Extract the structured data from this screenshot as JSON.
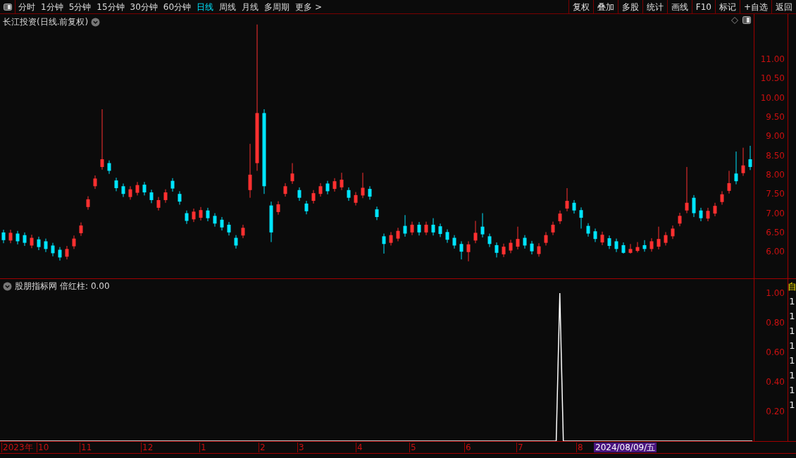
{
  "toolbar": {
    "periods": [
      {
        "label": "分时",
        "selected": false
      },
      {
        "label": "1分钟",
        "selected": false
      },
      {
        "label": "5分钟",
        "selected": false
      },
      {
        "label": "15分钟",
        "selected": false
      },
      {
        "label": "30分钟",
        "selected": false
      },
      {
        "label": "60分钟",
        "selected": false
      },
      {
        "label": "日线",
        "selected": true
      },
      {
        "label": "周线",
        "selected": false
      },
      {
        "label": "月线",
        "selected": false
      },
      {
        "label": "多周期",
        "selected": false
      },
      {
        "label": "更多 >",
        "selected": false
      }
    ],
    "buttons": [
      "复权",
      "叠加",
      "多股",
      "统计",
      "画线",
      "F10",
      "标记",
      "+自选",
      "返回"
    ]
  },
  "price_panel": {
    "title": "长江投资(日线.前复权)",
    "chart_data": {
      "type": "candlestick",
      "ylim": [
        5.29,
        12.17
      ],
      "yticks": [
        {
          "value": 11,
          "label": "11.00"
        },
        {
          "value": 10.5,
          "label": "10.50"
        },
        {
          "value": 10,
          "label": "10.00"
        },
        {
          "value": 9.5,
          "label": "9.50"
        },
        {
          "value": 9,
          "label": "9.00"
        },
        {
          "value": 8.5,
          "label": "8.50"
        },
        {
          "value": 8,
          "label": "8.00"
        },
        {
          "value": 7.5,
          "label": "7.50"
        },
        {
          "value": 7,
          "label": "7.00"
        },
        {
          "value": 6.5,
          "label": "6.50"
        },
        {
          "value": 6,
          "label": "6.00"
        }
      ],
      "ohlc": [
        [
          6.5,
          6.57,
          6.22,
          6.3
        ],
        [
          6.29,
          6.57,
          6.22,
          6.49
        ],
        [
          6.47,
          6.54,
          6.19,
          6.27
        ],
        [
          6.43,
          6.5,
          6.15,
          6.23
        ],
        [
          6.16,
          6.44,
          6.09,
          6.36
        ],
        [
          6.32,
          6.39,
          6.04,
          6.12
        ],
        [
          6.27,
          6.34,
          5.99,
          6.07
        ],
        [
          6.16,
          6.23,
          5.88,
          5.96
        ],
        [
          6.05,
          6.12,
          5.77,
          5.85
        ],
        [
          5.87,
          6.15,
          5.8,
          6.07
        ],
        [
          6.14,
          6.42,
          6.07,
          6.34
        ],
        [
          6.48,
          6.76,
          6.41,
          6.68
        ],
        [
          7.16,
          7.44,
          7.09,
          7.36
        ],
        [
          7.7,
          7.98,
          7.63,
          7.9
        ],
        [
          8.2,
          9.7,
          8.13,
          8.4
        ],
        [
          8.3,
          8.37,
          8.02,
          8.1
        ],
        [
          7.85,
          7.92,
          7.57,
          7.65
        ],
        [
          7.7,
          7.77,
          7.42,
          7.5
        ],
        [
          7.42,
          7.7,
          7.35,
          7.62
        ],
        [
          7.53,
          7.81,
          7.46,
          7.73
        ],
        [
          7.74,
          7.81,
          7.46,
          7.54
        ],
        [
          7.54,
          7.61,
          7.26,
          7.34
        ],
        [
          7.14,
          7.42,
          7.07,
          7.34
        ],
        [
          7.34,
          7.62,
          7.27,
          7.54
        ],
        [
          7.84,
          7.91,
          7.56,
          7.64
        ],
        [
          7.5,
          7.57,
          7.22,
          7.3
        ],
        [
          7.0,
          7.07,
          6.72,
          6.8
        ],
        [
          6.84,
          7.12,
          6.77,
          7.04
        ],
        [
          6.88,
          7.16,
          6.81,
          7.08
        ],
        [
          7.07,
          7.14,
          6.79,
          6.87
        ],
        [
          6.93,
          7.0,
          6.65,
          6.73
        ],
        [
          6.83,
          6.9,
          6.55,
          6.63
        ],
        [
          6.7,
          6.77,
          6.42,
          6.5
        ],
        [
          6.36,
          6.43,
          6.08,
          6.16
        ],
        [
          6.42,
          6.7,
          6.35,
          6.62
        ],
        [
          7.6,
          8.8,
          7.4,
          8.0
        ],
        [
          8.3,
          11.9,
          8.1,
          9.6
        ],
        [
          9.6,
          9.7,
          7.5,
          7.7
        ],
        [
          7.2,
          7.3,
          6.25,
          6.5
        ],
        [
          7.03,
          7.31,
          6.96,
          7.23
        ],
        [
          7.5,
          7.78,
          7.43,
          7.7
        ],
        [
          7.83,
          8.3,
          7.76,
          8.03
        ],
        [
          7.6,
          7.67,
          7.32,
          7.4
        ],
        [
          7.25,
          7.32,
          6.97,
          7.05
        ],
        [
          7.32,
          7.6,
          7.25,
          7.52
        ],
        [
          7.5,
          7.78,
          7.43,
          7.7
        ],
        [
          7.77,
          7.84,
          7.49,
          7.57
        ],
        [
          7.63,
          7.91,
          7.56,
          7.83
        ],
        [
          7.67,
          8.05,
          7.6,
          7.87
        ],
        [
          7.6,
          7.67,
          7.32,
          7.4
        ],
        [
          7.27,
          7.55,
          7.2,
          7.47
        ],
        [
          7.46,
          8.05,
          7.39,
          7.66
        ],
        [
          7.63,
          7.7,
          7.35,
          7.43
        ],
        [
          7.1,
          7.17,
          6.82,
          6.9
        ],
        [
          6.4,
          6.47,
          5.95,
          6.2
        ],
        [
          6.23,
          6.51,
          6.16,
          6.43
        ],
        [
          6.34,
          6.62,
          6.27,
          6.54
        ],
        [
          6.67,
          6.95,
          6.39,
          6.47
        ],
        [
          6.5,
          6.78,
          6.43,
          6.7
        ],
        [
          6.7,
          6.77,
          6.42,
          6.5
        ],
        [
          6.5,
          6.78,
          6.43,
          6.7
        ],
        [
          6.7,
          6.87,
          6.42,
          6.5
        ],
        [
          6.66,
          6.73,
          6.38,
          6.46
        ],
        [
          6.51,
          6.58,
          6.23,
          6.31
        ],
        [
          6.36,
          6.43,
          6.08,
          6.16
        ],
        [
          6.2,
          6.27,
          5.8,
          6.0
        ],
        [
          5.99,
          6.27,
          5.75,
          6.19
        ],
        [
          6.29,
          6.8,
          6.22,
          6.49
        ],
        [
          6.65,
          7.0,
          6.37,
          6.45
        ],
        [
          6.4,
          6.47,
          6.12,
          6.2
        ],
        [
          6.17,
          6.24,
          5.85,
          5.97
        ],
        [
          5.93,
          6.21,
          5.86,
          6.13
        ],
        [
          6.03,
          6.31,
          5.96,
          6.23
        ],
        [
          6.13,
          6.65,
          6.06,
          6.33
        ],
        [
          6.36,
          6.43,
          6.08,
          6.16
        ],
        [
          6.21,
          6.28,
          5.93,
          6.01
        ],
        [
          5.94,
          6.22,
          5.87,
          6.14
        ],
        [
          6.23,
          6.51,
          6.16,
          6.43
        ],
        [
          6.5,
          6.78,
          6.43,
          6.7
        ],
        [
          6.79,
          7.07,
          6.72,
          6.99
        ],
        [
          7.12,
          7.65,
          7.05,
          7.32
        ],
        [
          7.27,
          7.34,
          6.99,
          7.07
        ],
        [
          7.08,
          7.15,
          6.6,
          6.88
        ],
        [
          6.67,
          6.74,
          6.39,
          6.47
        ],
        [
          6.53,
          6.6,
          6.25,
          6.33
        ],
        [
          6.24,
          6.52,
          6.17,
          6.44
        ],
        [
          6.35,
          6.42,
          6.07,
          6.15
        ],
        [
          6.27,
          6.34,
          5.99,
          6.07
        ],
        [
          6.17,
          6.24,
          5.95,
          5.97
        ],
        [
          5.97,
          6.2,
          5.95,
          6.07
        ],
        [
          6.02,
          6.25,
          5.98,
          6.12
        ],
        [
          6.17,
          6.3,
          6.0,
          6.07
        ],
        [
          6.07,
          6.35,
          6.0,
          6.27
        ],
        [
          6.13,
          6.65,
          6.06,
          6.33
        ],
        [
          6.23,
          6.51,
          6.16,
          6.43
        ],
        [
          6.4,
          6.68,
          6.33,
          6.6
        ],
        [
          6.73,
          7.01,
          6.66,
          6.93
        ],
        [
          7.07,
          8.2,
          7.0,
          7.27
        ],
        [
          7.4,
          7.47,
          6.9,
          7.0
        ],
        [
          7.07,
          7.14,
          6.79,
          6.87
        ],
        [
          6.86,
          7.14,
          6.79,
          7.06
        ],
        [
          6.99,
          7.27,
          6.92,
          7.19
        ],
        [
          7.29,
          7.57,
          7.22,
          7.49
        ],
        [
          7.58,
          8.1,
          7.51,
          7.78
        ],
        [
          8.03,
          8.6,
          7.75,
          7.83
        ],
        [
          8.04,
          8.7,
          7.97,
          8.24
        ],
        [
          8.4,
          8.75,
          8.12,
          8.2
        ]
      ]
    }
  },
  "indicator_panel": {
    "title": "股朋指标网",
    "separator": ":",
    "value_text": "0.00",
    "side_labels": [
      "自",
      "1",
      "1",
      "1",
      "1",
      "1",
      "1",
      "1",
      "1"
    ],
    "chart_data": {
      "type": "line",
      "ylim": [
        0,
        1.095
      ],
      "yticks": [
        {
          "value": 1,
          "label": "1.00"
        },
        {
          "value": 0.8,
          "label": "0.80"
        },
        {
          "value": 0.6,
          "label": "0.60"
        },
        {
          "value": 0.4,
          "label": "0.40"
        },
        {
          "value": 0.2,
          "label": "0.20"
        }
      ],
      "series": [
        {
          "name": "倍红柱",
          "color": "#ffffff",
          "values": [
            0,
            0,
            0,
            0,
            0,
            0,
            0,
            0,
            0,
            0,
            0,
            0,
            0,
            0,
            0,
            0,
            0,
            0,
            0,
            0,
            0,
            0,
            0,
            0,
            0,
            0,
            0,
            0,
            0,
            0,
            0,
            0,
            0,
            0,
            0,
            0,
            0,
            0,
            0,
            0,
            0,
            0,
            0,
            0,
            0,
            0,
            0,
            0,
            0,
            0,
            0,
            0,
            0,
            0,
            0,
            0,
            0,
            0,
            0,
            0,
            0,
            0,
            0,
            0,
            0,
            0,
            0,
            0,
            0,
            0,
            0,
            0,
            0,
            0,
            0,
            0,
            0,
            0,
            0,
            0,
            0,
            0,
            0,
            0,
            0,
            0,
            0,
            0,
            0,
            0,
            0,
            0,
            0,
            0,
            0,
            0,
            0,
            0,
            0,
            0,
            0,
            0,
            0,
            0,
            0,
            0,
            0,
            0,
            0,
            0,
            0,
            0,
            0,
            0,
            0,
            0,
            0,
            0,
            0,
            0,
            0,
            0,
            0,
            0,
            0,
            0,
            0,
            0,
            0,
            0,
            0,
            0,
            0,
            0,
            0,
            0,
            0,
            0,
            0,
            0,
            0,
            0,
            0,
            0,
            0,
            0,
            0,
            0,
            0,
            0,
            0,
            0,
            0,
            0,
            0,
            0,
            0,
            1,
            0,
            0,
            0,
            0,
            0,
            0,
            0,
            0,
            0,
            0,
            0,
            0,
            0,
            0,
            0,
            0,
            0,
            0,
            0,
            0,
            0,
            0,
            0,
            0,
            0,
            0,
            0,
            0,
            0,
            0,
            0,
            0,
            0,
            0,
            0,
            0,
            0,
            0,
            0,
            0,
            0,
            0,
            0,
            0,
            0,
            0,
            0,
            0,
            0,
            0,
            0,
            0,
            0,
            0
          ]
        }
      ]
    }
  },
  "date_axis": {
    "labels": [
      "2023年",
      "10",
      "11",
      "12",
      "1",
      "2",
      "3",
      "4",
      "5",
      "6",
      "7",
      "8"
    ],
    "cursor_date": "2024/08/09/五"
  }
}
